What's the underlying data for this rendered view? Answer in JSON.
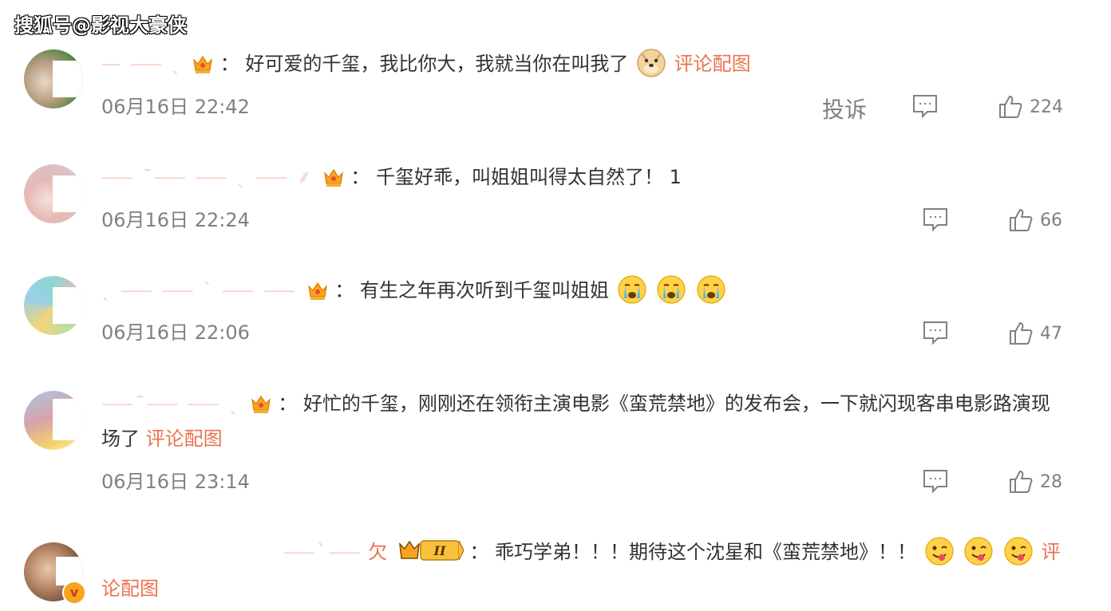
{
  "watermark": "搜狐号@影视大豪侠",
  "comments": [
    {
      "username": "",
      "text": "好可爱的千玺，我比你大，我就当你在叫我了",
      "image_link": "评论配图",
      "time": "06月16日 22:42",
      "report": "投诉",
      "likes": "224",
      "emoji": [
        "doge"
      ]
    },
    {
      "username": "",
      "text": "千玺好乖，叫姐姐叫得太自然了！ 1",
      "image_link": "",
      "time": "06月16日 22:24",
      "likes": "66",
      "emoji": []
    },
    {
      "username": "",
      "text": "有生之年再次听到千玺叫姐姐",
      "image_link": "",
      "time": "06月16日 22:06",
      "likes": "47",
      "emoji": [
        "crying",
        "crying",
        "crying"
      ]
    },
    {
      "username": "",
      "text": "好忙的千玺，刚刚还在领衔主演电影《蛮荒禁地》的发布会，一下就闪现客串电影路演现",
      "text_line2": "场了",
      "image_link": "评论配图",
      "time": "06月16日 23:14",
      "likes": "28",
      "emoji": []
    },
    {
      "username": "欠",
      "text": "乖巧学弟！！！期待这个沈星和《蛮荒禁地》！！",
      "image_link_part1": "评",
      "image_link_part2": "论配图",
      "time": "",
      "likes": "",
      "level_badge": "II",
      "emoji": [
        "tongue",
        "tongue",
        "tongue"
      ]
    }
  ],
  "separator": "：",
  "icons": {
    "reply": "comment-icon",
    "like": "thumbs-up-icon",
    "crown": "crown-icon"
  },
  "colors": {
    "text": "#333333",
    "meta": "#808080",
    "link": "#eb7350",
    "crown": "#f9a31e"
  }
}
